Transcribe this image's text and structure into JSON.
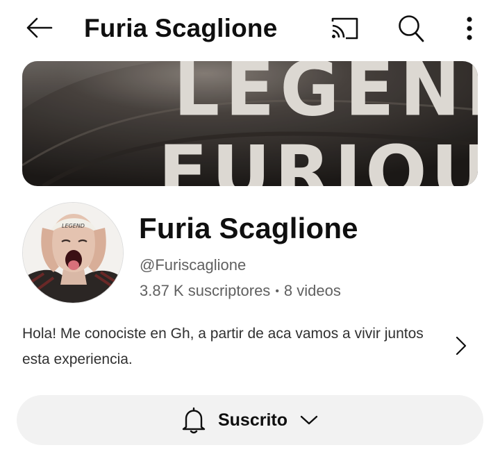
{
  "header": {
    "title": "Furia Scaglione",
    "back_icon": "arrow-left-icon",
    "cast_icon": "cast-icon",
    "search_icon": "search-icon",
    "more_icon": "more-vertical-icon"
  },
  "banner": {
    "text_line1": "LEGEND",
    "text_line2": "FURIOUS"
  },
  "avatar": {
    "tattoo_text": "LEGEND"
  },
  "channel": {
    "name": "Furia Scaglione",
    "handle": "@Furiscaglione",
    "subscribers": "3.87 K suscriptores",
    "separator": "•",
    "videos": "8 videos"
  },
  "description": {
    "text": "Hola! Me conociste en Gh, a partir de aca vamos a vivir juntos esta experiencia."
  },
  "subscribe_button": {
    "label": "Suscrito"
  },
  "colors": {
    "text_primary": "#0f0f0f",
    "text_secondary": "#606060",
    "button_bg": "#f2f2f2"
  }
}
